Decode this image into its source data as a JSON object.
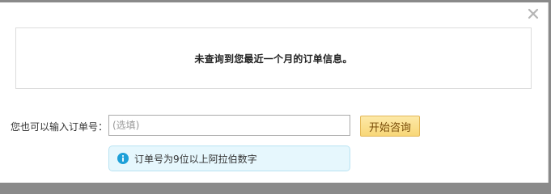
{
  "dialog": {
    "close_icon": "close-icon",
    "notice_text": "未查询到您最近一个月的订单信息。",
    "order_label": "您也可以输入订单号：",
    "order_input": {
      "value": "",
      "placeholder": "(选填)"
    },
    "start_button_label": "开始咨询",
    "tip_icon": "info-icon",
    "tip_text": "订单号为9位以上阿拉伯数字"
  },
  "colors": {
    "button_bg": "#f8d778",
    "button_border": "#e3b757",
    "tip_bg": "#e6f7fd",
    "tip_border": "#b9e3f2",
    "info_icon": "#1ea0d8"
  }
}
